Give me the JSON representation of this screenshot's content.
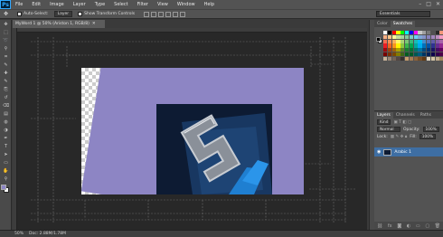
{
  "app": {
    "logo": "Ps"
  },
  "menu": [
    "File",
    "Edit",
    "Image",
    "Layer",
    "Type",
    "Select",
    "Filter",
    "View",
    "Window",
    "Help"
  ],
  "window_controls": [
    "–",
    "□",
    "✕"
  ],
  "options": {
    "auto_select_label": "Auto-Select:",
    "auto_select_value": "Layer",
    "transform_label": "Show Transform Controls"
  },
  "workspace": "Essentials",
  "document": {
    "tab_title": "MyWord 1 @ 50% (Ariston 1, RGB/8)",
    "close_glyph": "✕"
  },
  "status": {
    "zoom": "50%",
    "doc_info": "Doc: 2.88M/1.78M"
  },
  "panels": {
    "color_tabs": [
      "Color",
      "Swatches"
    ],
    "layers_tabs": [
      "Layers",
      "Channels",
      "Paths"
    ],
    "kind_label": "Kind",
    "blend_mode": "Normal",
    "opacity_label": "Opacity:",
    "opacity_value": "100%",
    "lock_label": "Lock:",
    "fill_label": "Fill:",
    "fill_value": "100%",
    "layer_name": "Arabic 1"
  },
  "swatch_colors": [
    "#ffffff",
    "#000000",
    "#ff0000",
    "#ffff00",
    "#00ff00",
    "#00ffff",
    "#0000ff",
    "#ff00ff",
    "#c8c8c8",
    "#a0a0a0",
    "#787878",
    "#505050",
    "#282828",
    "#f7977a",
    "#f9ad81",
    "#fdc68a",
    "#fff79a",
    "#c4df9b",
    "#a2d39c",
    "#82ca9d",
    "#7bcdc8",
    "#6ecff6",
    "#7ea7d8",
    "#8493ca",
    "#8882be",
    "#a187be",
    "#bc8dbf",
    "#f49ac2",
    "#f26c4f",
    "#f68e55",
    "#fbaf5c",
    "#fff467",
    "#acd372",
    "#7cc576",
    "#3bb878",
    "#1abbb4",
    "#00bff3",
    "#438ccb",
    "#5574b9",
    "#605ca8",
    "#855fa8",
    "#a763a8",
    "#ed1c24",
    "#f26522",
    "#f7941d",
    "#fff200",
    "#8dc73f",
    "#39b54a",
    "#00a651",
    "#00a99d",
    "#00aeef",
    "#0072bc",
    "#0054a6",
    "#2e3192",
    "#662d91",
    "#92278f",
    "#9e0b0f",
    "#a0410d",
    "#a3620a",
    "#aba000",
    "#598527",
    "#1a7b30",
    "#007236",
    "#00746b",
    "#0076a3",
    "#004b80",
    "#003471",
    "#1b1464",
    "#440e62",
    "#630460",
    "#790000",
    "#7b2e00",
    "#7d4900",
    "#827b00",
    "#406618",
    "#005e20",
    "#005826",
    "#005952",
    "#005b7f",
    "#003663",
    "#002157",
    "#0d004c",
    "#32004b",
    "#4b0049",
    "#c7b299",
    "#998675",
    "#736357",
    "#534741",
    "#37302d",
    "#c69c6d",
    "#a67c52",
    "#8c6239",
    "#754c24",
    "#603913",
    "#e2d8c3",
    "#d3c5a6",
    "#bfa98a",
    "#a3895c"
  ],
  "colors": {
    "accent": "#3e6ea3",
    "canvas_purple": "#8d85c4",
    "logo_blue": "#31a8ff"
  },
  "icons": [
    "move-tool-icon",
    "marquee-tool-icon",
    "lasso-tool-icon",
    "quick-select-icon",
    "crop-tool-icon",
    "eyedropper-icon",
    "healing-brush-icon",
    "brush-tool-icon",
    "clone-stamp-icon",
    "history-brush-icon",
    "eraser-icon",
    "gradient-icon",
    "blur-icon",
    "dodge-icon",
    "pen-tool-icon",
    "type-tool-icon",
    "path-select-icon",
    "shape-tool-icon",
    "hand-tool-icon",
    "zoom-tool-icon"
  ]
}
